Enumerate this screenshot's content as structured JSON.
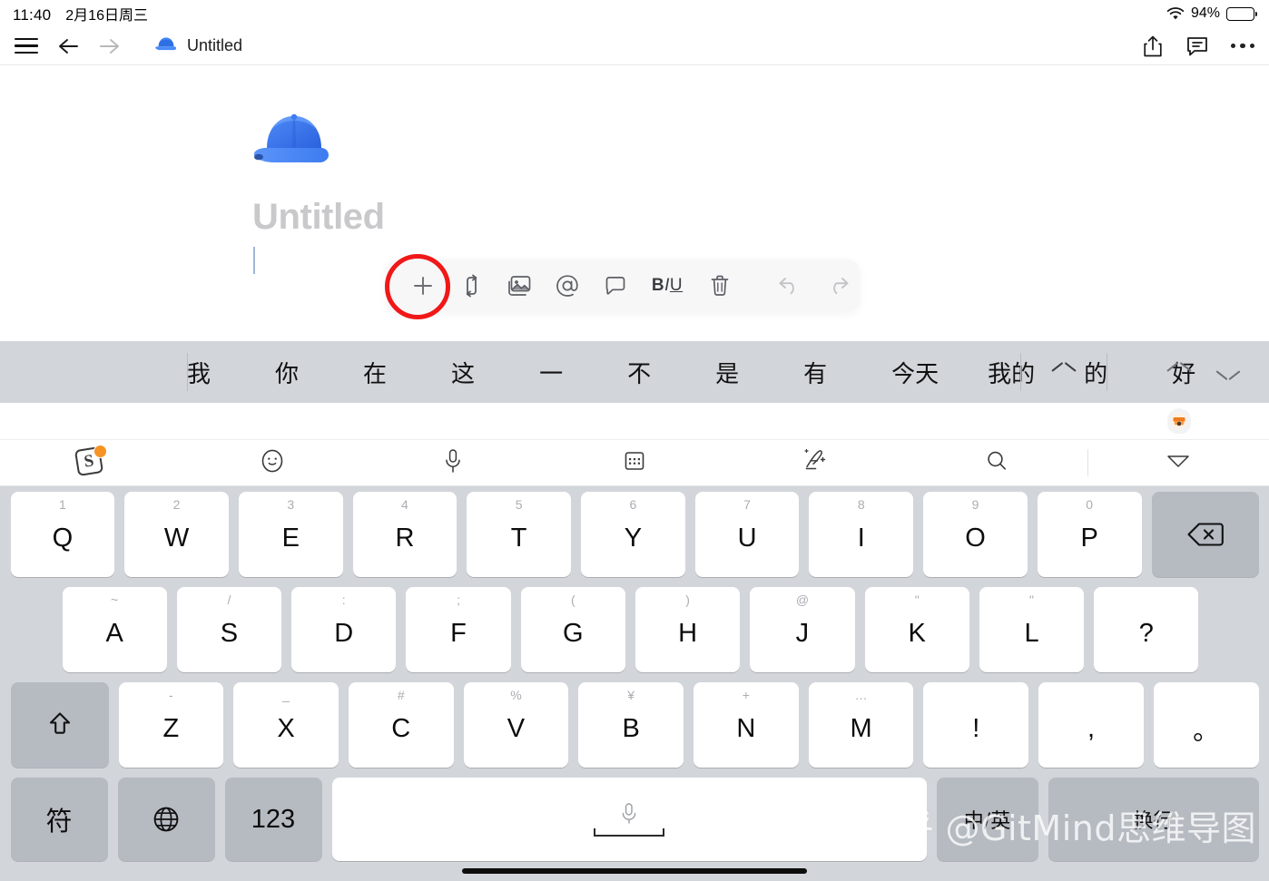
{
  "status_bar": {
    "time": "11:40",
    "date": "2月16日周三",
    "battery_percent": "94%",
    "battery_level": 94,
    "wifi_icon": "wifi-icon",
    "battery_icon": "battery-icon"
  },
  "nav_bar": {
    "menu_icon": "hamburger-menu-icon",
    "back_icon": "arrow-left-icon",
    "forward_icon": "arrow-right-icon",
    "doc_emoji": "blue-cap-emoji",
    "doc_title": "Untitled",
    "share_icon": "share-icon",
    "comment_icon": "comment-icon",
    "more_icon": "more-dots-icon"
  },
  "document": {
    "emoji": "🧢",
    "heading_placeholder": "Untitled",
    "body_text": "",
    "caret_visible": true
  },
  "format_toolbar": {
    "buttons": [
      {
        "name": "add-block-button",
        "label": "+",
        "icon": "plus-icon",
        "dim": false
      },
      {
        "name": "move-block-button",
        "label": "",
        "icon": "move-arrows-icon",
        "dim": false
      },
      {
        "name": "insert-image-button",
        "label": "",
        "icon": "image-icon",
        "dim": false
      },
      {
        "name": "mention-button",
        "label": "@",
        "icon": "at-icon",
        "dim": false
      },
      {
        "name": "comment-button",
        "label": "",
        "icon": "comment-bubble-icon",
        "dim": false
      },
      {
        "name": "text-style-button",
        "label": "BIU",
        "icon": "bold-italic-underline-icon",
        "dim": false
      },
      {
        "name": "delete-block-button",
        "label": "",
        "icon": "trash-icon",
        "dim": false
      },
      {
        "name": "undo-button",
        "label": "",
        "icon": "undo-icon",
        "dim": true
      },
      {
        "name": "redo-button",
        "label": "",
        "icon": "redo-icon",
        "dim": true
      }
    ],
    "highlight": {
      "target": "add-block-button",
      "shape": "circle",
      "color": "#f01818"
    }
  },
  "ime": {
    "candidates": [
      "我",
      "你",
      "在",
      "这",
      "一",
      "不",
      "是",
      "有",
      "今天",
      "我的",
      "的",
      "好"
    ],
    "expand_icon": "chevron-up-icon",
    "page_up_icon": "chevron-up-icon",
    "page_down_icon": "chevron-down-icon",
    "avatar_icon": "user-avatar-icon",
    "toolbar": [
      {
        "name": "sogou-logo-button",
        "icon": "sogou-logo-icon",
        "label": "S"
      },
      {
        "name": "emoji-button",
        "icon": "emoji-face-icon"
      },
      {
        "name": "voice-input-button",
        "icon": "microphone-icon"
      },
      {
        "name": "keyboard-layout-button",
        "icon": "keyboard-grid-icon"
      },
      {
        "name": "handwriting-button",
        "icon": "pen-write-icon"
      },
      {
        "name": "search-button",
        "icon": "search-icon"
      },
      {
        "name": "hide-keyboard-button",
        "icon": "chevron-down-triangle-icon"
      }
    ]
  },
  "keyboard": {
    "row1": [
      {
        "main": "Q",
        "sub": "1"
      },
      {
        "main": "W",
        "sub": "2"
      },
      {
        "main": "E",
        "sub": "3"
      },
      {
        "main": "R",
        "sub": "4"
      },
      {
        "main": "T",
        "sub": "5"
      },
      {
        "main": "Y",
        "sub": "6"
      },
      {
        "main": "U",
        "sub": "7"
      },
      {
        "main": "I",
        "sub": "8"
      },
      {
        "main": "O",
        "sub": "9"
      },
      {
        "main": "P",
        "sub": "0"
      }
    ],
    "backspace": {
      "name": "backspace-key",
      "icon": "backspace-icon"
    },
    "row2": [
      {
        "main": "A",
        "sub": "~"
      },
      {
        "main": "S",
        "sub": "/"
      },
      {
        "main": "D",
        "sub": ":"
      },
      {
        "main": "F",
        "sub": ";"
      },
      {
        "main": "G",
        "sub": "("
      },
      {
        "main": "H",
        "sub": ")"
      },
      {
        "main": "J",
        "sub": "@"
      },
      {
        "main": "K",
        "sub": "\""
      },
      {
        "main": "L",
        "sub": "\""
      },
      {
        "main": "?",
        "sub": ""
      }
    ],
    "shift": {
      "name": "shift-key",
      "icon": "shift-arrow-icon"
    },
    "row3": [
      {
        "main": "Z",
        "sub": "-"
      },
      {
        "main": "X",
        "sub": "_"
      },
      {
        "main": "C",
        "sub": "#"
      },
      {
        "main": "V",
        "sub": "%"
      },
      {
        "main": "B",
        "sub": "¥"
      },
      {
        "main": "N",
        "sub": "+"
      },
      {
        "main": "M",
        "sub": "…"
      },
      {
        "main": "!",
        "sub": ""
      },
      {
        "main": ",",
        "sub": ""
      },
      {
        "main": "。",
        "sub": ""
      }
    ],
    "row4": {
      "symbols": {
        "name": "symbols-key",
        "label": "符"
      },
      "globe": {
        "name": "globe-key",
        "icon": "globe-icon"
      },
      "numbers": {
        "name": "numbers-key",
        "label": "123"
      },
      "space": {
        "name": "space-key",
        "icon": "microphone-icon",
        "label": ""
      },
      "cn_en": {
        "name": "chinese-english-toggle-key",
        "label": "中/英"
      },
      "enter": {
        "name": "enter-key",
        "label": "换行"
      }
    }
  },
  "watermark": {
    "text": "知乎 @GitMind思维导图"
  }
}
